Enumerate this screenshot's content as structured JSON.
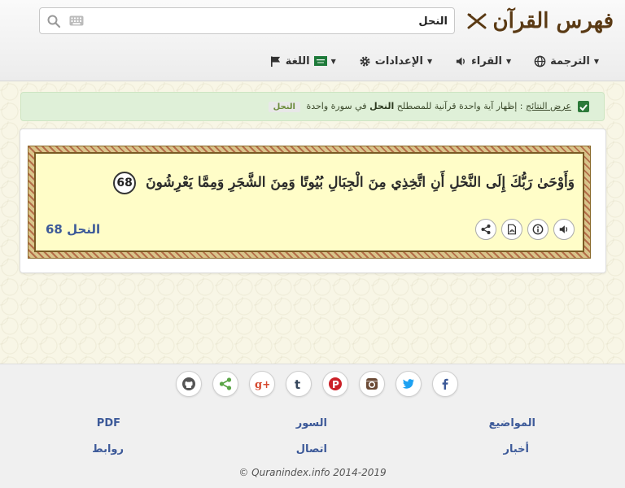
{
  "header": {
    "logo_text": "فهرس القرآن",
    "search": {
      "value": "النحل",
      "placeholder": ""
    },
    "nav": [
      {
        "label": "الترجمة",
        "icon": "globe-icon"
      },
      {
        "label": "القراء",
        "icon": "speaker-icon"
      },
      {
        "label": "الإعدادات",
        "icon": "gear-icon"
      },
      {
        "label": "اللغة",
        "icon": "flag-icon"
      }
    ]
  },
  "alert": {
    "prefix": "عرض النتائج",
    "text": ": إظهار آية واحدة قرآنية للمصطلح",
    "term": "النحل",
    "suffix": "في سورة واحدة",
    "badge": "النحل"
  },
  "verse": {
    "text": "وَأَوْحَىٰ رَبُّكَ إِلَى النَّحْلِ أَنِ اتَّخِذِي مِنَ الْجِبَالِ بُيُوتًا وَمِنَ الشَّجَرِ وَمِمَّا يَعْرِشُونَ",
    "number": "68",
    "reference": "النحل 68"
  },
  "footer": {
    "links": {
      "topics": "المواضيع",
      "surahs": "السور",
      "pdf": "PDF",
      "news": "أخبار",
      "contact": "اتصال",
      "links": "روابط"
    },
    "copyright": "© Quranindex.info 2014-2019"
  },
  "colors": {
    "accent_blue": "#3d5a99",
    "alert_bg": "#dff0d8",
    "verse_bg": "#fffdc8"
  }
}
